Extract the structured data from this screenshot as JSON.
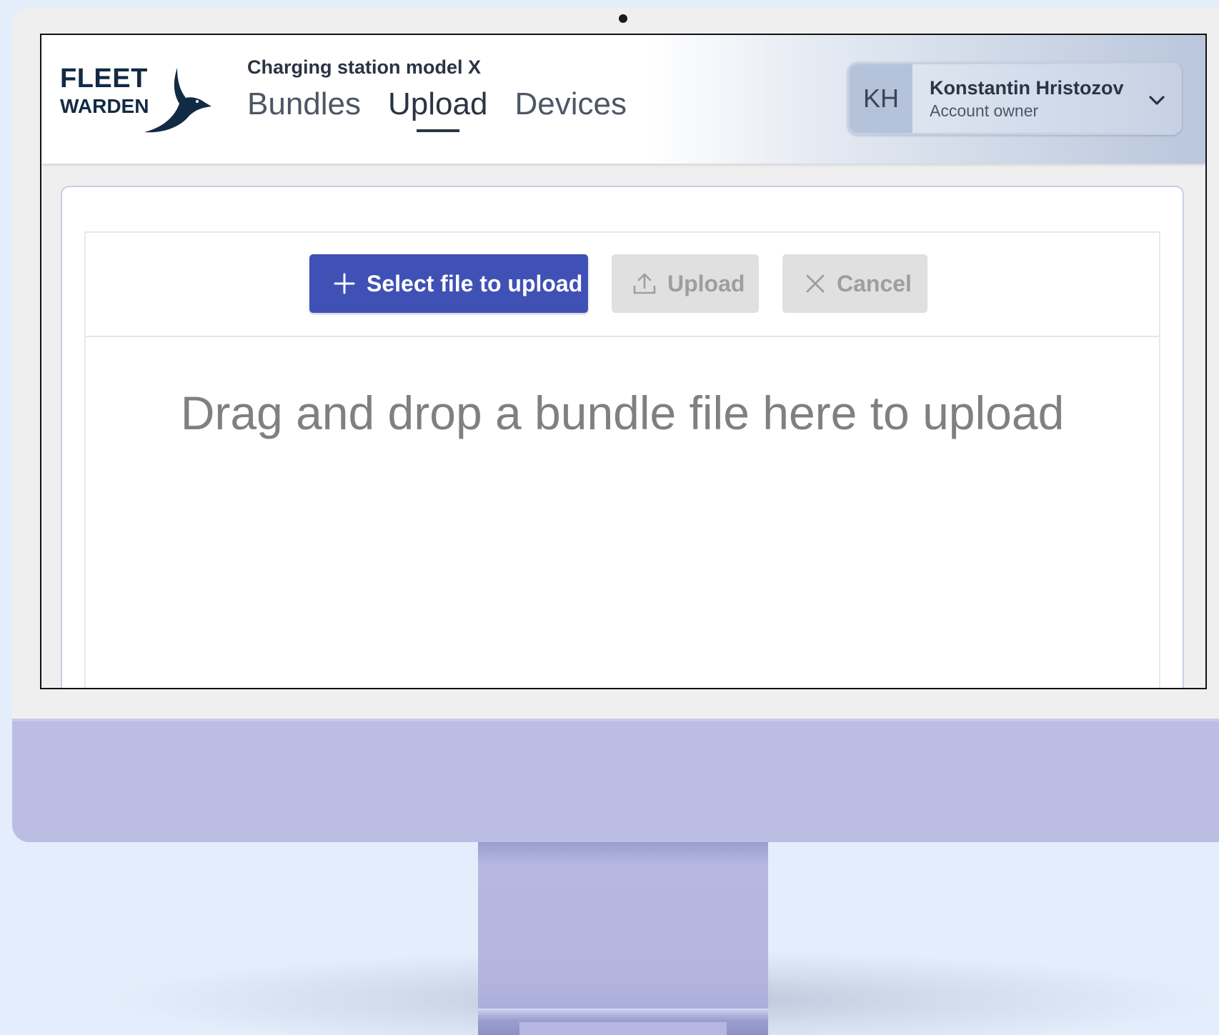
{
  "app": {
    "logo_line1": "FLEET",
    "logo_line2": "WARDEN",
    "project_name": "Charging station model X"
  },
  "nav": {
    "tabs": [
      {
        "label": "Bundles",
        "active": false
      },
      {
        "label": "Upload",
        "active": true
      },
      {
        "label": "Devices",
        "active": false
      }
    ]
  },
  "account": {
    "initials": "KH",
    "name": "Konstantin Hristozov",
    "role": "Account owner"
  },
  "toolbar": {
    "select_label": "Select file to upload",
    "upload_label": "Upload",
    "cancel_label": "Cancel"
  },
  "dropzone": {
    "text": "Drag and drop a bundle file here to upload"
  },
  "colors": {
    "primary": "#3f51b5",
    "brand_navy": "#122a44",
    "disabled_bg": "#e0e0e0",
    "disabled_text": "#9e9e9e",
    "device_body": "#bbbde2"
  },
  "icons": {
    "select": "plus-icon",
    "upload": "upload-icon",
    "cancel": "close-icon",
    "account_menu": "chevron-down-icon"
  }
}
